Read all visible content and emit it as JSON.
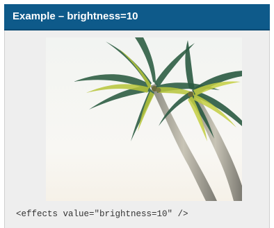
{
  "slide": {
    "title": "Example – brightness=10",
    "code": "<effects value=\"brightness=10\" />"
  },
  "image": {
    "subject": "palm-trees-icon"
  },
  "colors": {
    "header_bg": "#0e5a8a",
    "panel_bg": "#eeeeee"
  }
}
